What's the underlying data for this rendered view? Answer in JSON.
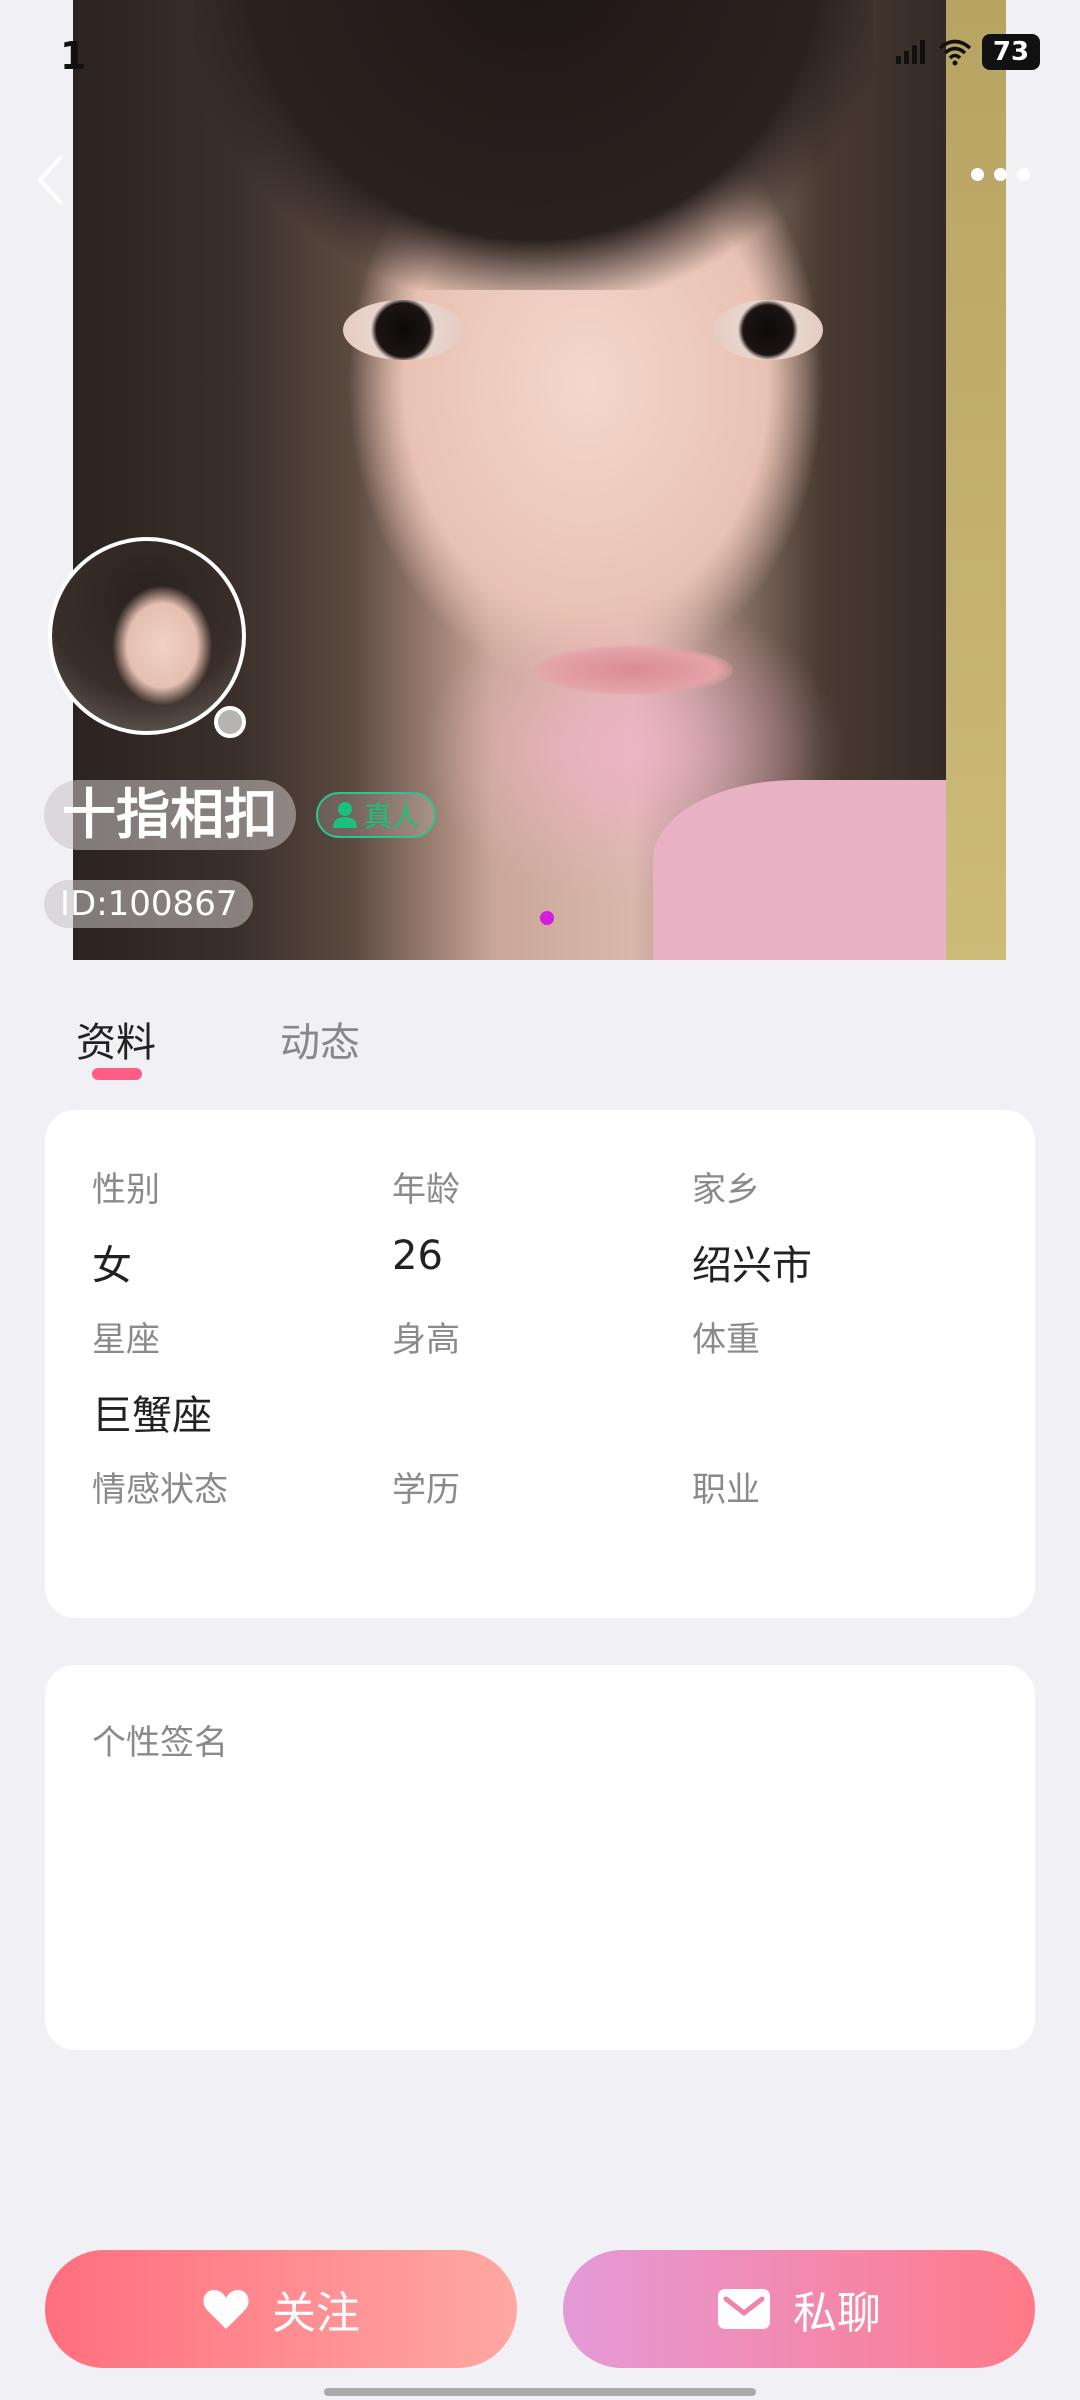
{
  "status_bar": {
    "time": "1",
    "battery": "73"
  },
  "profile": {
    "nickname": "十指相扣",
    "verified_label": "真人",
    "user_id": "ID:100867"
  },
  "tabs": [
    {
      "label": "资料",
      "active": true
    },
    {
      "label": "动态",
      "active": false
    }
  ],
  "info": {
    "gender": {
      "label": "性别",
      "value": "女"
    },
    "age": {
      "label": "年龄",
      "value": "26"
    },
    "hometown": {
      "label": "家乡",
      "value": "绍兴市"
    },
    "zodiac": {
      "label": "星座",
      "value": "巨蟹座"
    },
    "height": {
      "label": "身高",
      "value": ""
    },
    "weight": {
      "label": "体重",
      "value": ""
    },
    "relationship": {
      "label": "情感状态",
      "value": ""
    },
    "education": {
      "label": "学历",
      "value": ""
    },
    "occupation": {
      "label": "职业",
      "value": ""
    }
  },
  "signature": {
    "label": "个性签名"
  },
  "actions": {
    "follow_label": "关注",
    "chat_label": "私聊"
  },
  "colors": {
    "accent_pink": "#ff5d86",
    "verified_green": "#19c07e",
    "carousel_dot": "#d41ddc"
  }
}
